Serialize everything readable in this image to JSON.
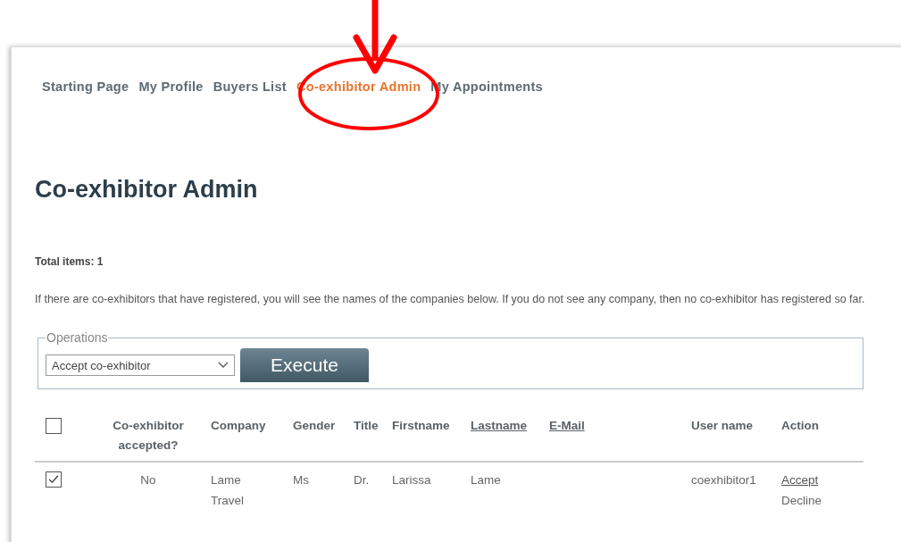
{
  "nav": [
    {
      "label": "Starting Page",
      "selected": false
    },
    {
      "label": "My Profile",
      "selected": false
    },
    {
      "label": "Buyers List",
      "selected": false
    },
    {
      "label": "Co-exhibitor Admin",
      "selected": true
    },
    {
      "label": "My Appointments",
      "selected": false
    }
  ],
  "title": "Co-exhibitor Admin",
  "total_items": "Total items: 1",
  "info": "If there are co-exhibitors that have registered, you will see the names of the companies below. If you do not see any company, then no co-exhibitor has registered so far.",
  "operations": {
    "legend": "Operations",
    "select_value": "Accept co-exhibitor",
    "button": "Execute"
  },
  "table": {
    "select_all_checked": false,
    "columns": [
      {
        "label": "Co-exhibitor accepted?",
        "sortable": false
      },
      {
        "label": "Company",
        "sortable": false
      },
      {
        "label": "Gender",
        "sortable": false
      },
      {
        "label": "Title",
        "sortable": false
      },
      {
        "label": "Firstname",
        "sortable": false
      },
      {
        "label": "Lastname",
        "sortable": true
      },
      {
        "label": "E-Mail",
        "sortable": true
      },
      {
        "label": "User name",
        "sortable": false
      },
      {
        "label": "Action",
        "sortable": false
      }
    ],
    "rows": [
      {
        "checked": true,
        "cells": [
          "No",
          "Lame Travel",
          "Ms",
          "Dr.",
          "Larissa",
          "Lame",
          "",
          "coexhibitor1"
        ],
        "actions": [
          {
            "label": "Accept",
            "kind": "link"
          },
          {
            "label": "Decline",
            "kind": "text"
          }
        ]
      }
    ]
  }
}
